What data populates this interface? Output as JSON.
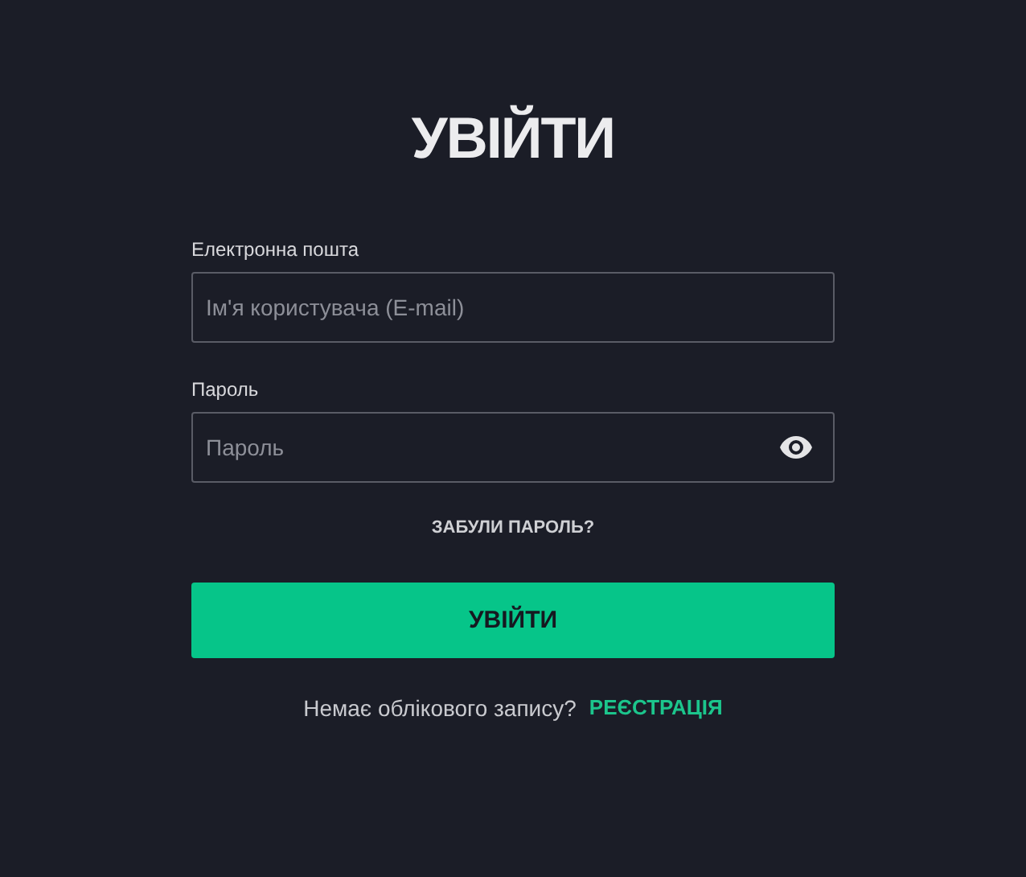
{
  "title": "УВІЙТИ",
  "fields": [
    {
      "label": "Електронна пошта",
      "placeholder": "Ім'я користувача (E-mail)",
      "kind": "text"
    },
    {
      "label": "Пароль",
      "placeholder": "Пароль",
      "kind": "password"
    }
  ],
  "forgot_link": "ЗАБУЛИ ПАРОЛЬ?",
  "submit_button": "УВІЙТИ",
  "signup": {
    "text": "Немає облікового запису?",
    "link": "РЕЄСТРАЦІЯ"
  }
}
